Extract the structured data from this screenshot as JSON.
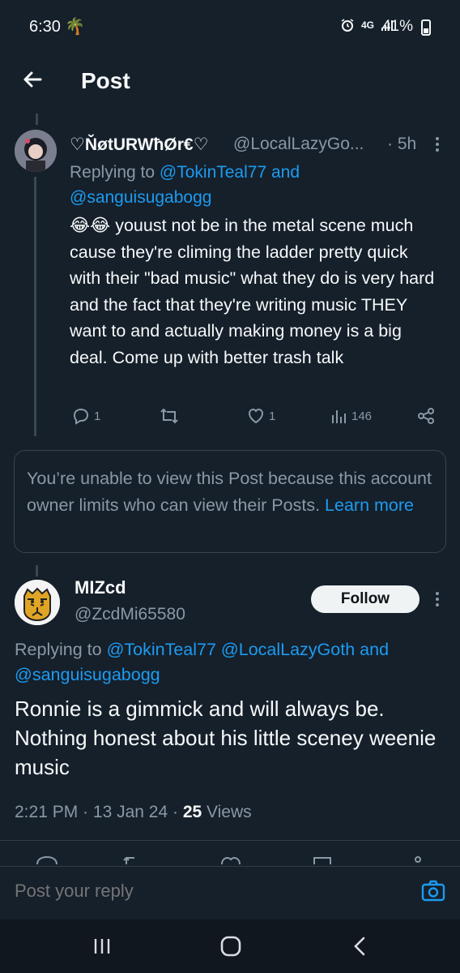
{
  "status": {
    "time": "6:30",
    "battery": "41%"
  },
  "header": {
    "title": "Post"
  },
  "tweet1": {
    "display_name": "♡ŇøtURWħØr€♡",
    "handle": "@LocalLazyGo...",
    "time": "· 5h",
    "replying_prefix": "Replying to",
    "reply_to_1": "@TokinTeal77",
    "reply_and": "and",
    "reply_to_2": "@sanguisugabogg",
    "body": "😂😂 youust not be in the metal scene much cause they're climing the ladder pretty quick with their \"bad music\" what they do is very hard and the fact that they're writing music THEY want to and actually making money is a big deal. Come up with better trash talk",
    "replies": "1",
    "likes": "1",
    "views": "146"
  },
  "limited": {
    "text": "You’re unable to view this Post because this account owner limits who can view their Posts.",
    "link": "Learn more"
  },
  "tweet2": {
    "display_name": "MIZcd",
    "handle": "@ZcdMi65580",
    "follow_label": "Follow",
    "replying_prefix": "Replying to",
    "reply_to_1": "@TokinTeal77",
    "reply_to_2": "@LocalLazyGoth",
    "reply_and": "and",
    "reply_to_3": "@sanguisugabogg",
    "body": "Ronnie is a gimmick and will always be. Nothing honest about his little sceney weenie music",
    "time": "2:21 PM",
    "date": "13 Jan 24",
    "views_count": "25",
    "views_label": "Views"
  },
  "composer": {
    "placeholder": "Post your reply"
  },
  "colors": {
    "background": "#15202b",
    "link": "#1d9bf0",
    "muted": "#8b98a5"
  }
}
